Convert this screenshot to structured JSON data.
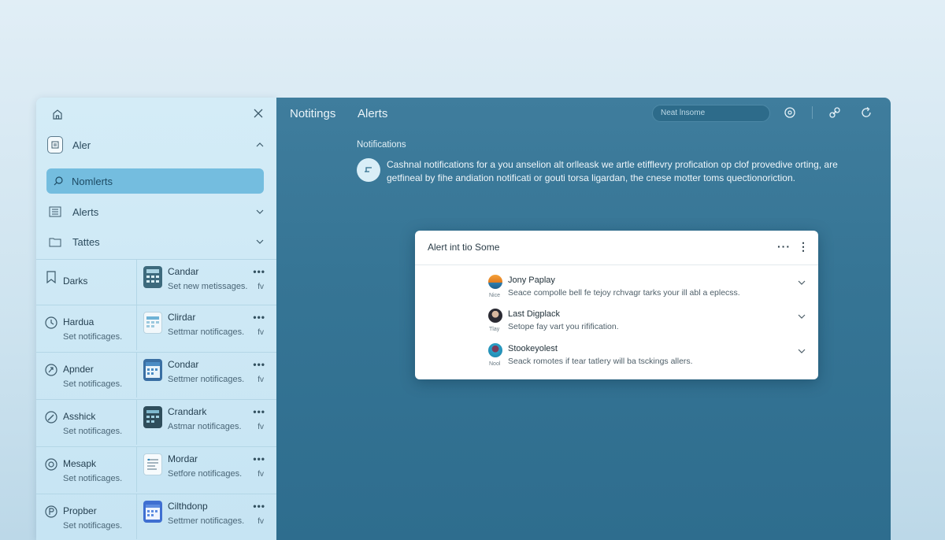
{
  "sidebar": {
    "header": {
      "home_icon": "home-icon",
      "close_icon": "close-icon"
    },
    "account": {
      "label": "Aler",
      "icon": "alert-box-icon"
    },
    "search": {
      "label": "Nomlerts"
    },
    "nav": [
      {
        "label": "Alerts",
        "icon": "list-icon"
      },
      {
        "label": "Tattes",
        "icon": "folder-icon"
      }
    ],
    "grid_rows": [
      {
        "left": {
          "title": "Darks",
          "sub": "",
          "icon": "bookmark-icon"
        },
        "right": {
          "title": "Candar",
          "sub": "Set new metissages.",
          "fav": "fv",
          "icon": "calculator-app-icon"
        }
      },
      {
        "left": {
          "title": "Hardua",
          "sub": "Set notificages.",
          "icon": "clock-icon"
        },
        "right": {
          "title": "Clirdar",
          "sub": "Settmar notificages.",
          "fav": "fv",
          "icon": "calendar-app-icon"
        }
      },
      {
        "left": {
          "title": "Apnder",
          "sub": "Set notificages.",
          "icon": "refresh-circle-icon"
        },
        "right": {
          "title": "Condar",
          "sub": "Settmer notificages.",
          "fav": "fv",
          "icon": "calendar-grid-icon"
        }
      },
      {
        "left": {
          "title": "Asshick",
          "sub": "Set notificages.",
          "icon": "pen-circle-icon"
        },
        "right": {
          "title": "Crandark",
          "sub": "Astmar notificages.",
          "fav": "fv",
          "icon": "dark-calendar-icon"
        }
      },
      {
        "left": {
          "title": "Mesapk",
          "sub": "Set notificages.",
          "icon": "target-circle-icon"
        },
        "right": {
          "title": "Mordar",
          "sub": "Setfore notificages.",
          "fav": "fv",
          "icon": "document-app-icon"
        }
      },
      {
        "left": {
          "title": "Propber",
          "sub": "Set notificages.",
          "icon": "p-circle-icon"
        },
        "right": {
          "title": "Cilthdonp",
          "sub": "Settmer notificages.",
          "fav": "fv",
          "icon": "blue-calendar-icon"
        }
      }
    ],
    "dots": "•••"
  },
  "main": {
    "tabs": [
      {
        "label": "Notitings"
      },
      {
        "label": "Alerts"
      }
    ],
    "search_placeholder": "Neat lnsome",
    "toolbar_icons": [
      "settings-icon",
      "link-icon",
      "refresh-icon"
    ],
    "heading": "Notifications",
    "description": "Cashnal notifications for a you anselion alt orlleask we artle etifflevry profication op clof provedive orting, are getfineal by fihe andiation notificati or gouti torsa ligardan, the cnese motter toms quectionoriction.",
    "card": {
      "title": "Alert int tio Some",
      "items": [
        {
          "name": "Jony Paplay",
          "desc": "Seace compolle bell fe tejoy rchvagr tarks your ill abl a eplecss.",
          "tag": "Nice",
          "avatar_color": "#f0902a"
        },
        {
          "name": "Last Digplack",
          "desc": "Setope fay vart you rifification.",
          "tag": "Tlay",
          "avatar_color": "#2a2a33"
        },
        {
          "name": "Stookeyolest",
          "desc": "Seack romotes if tear tatlery will ba tsckings allers.",
          "tag": "Nool",
          "avatar_color": "#2aa0c8"
        }
      ]
    }
  }
}
